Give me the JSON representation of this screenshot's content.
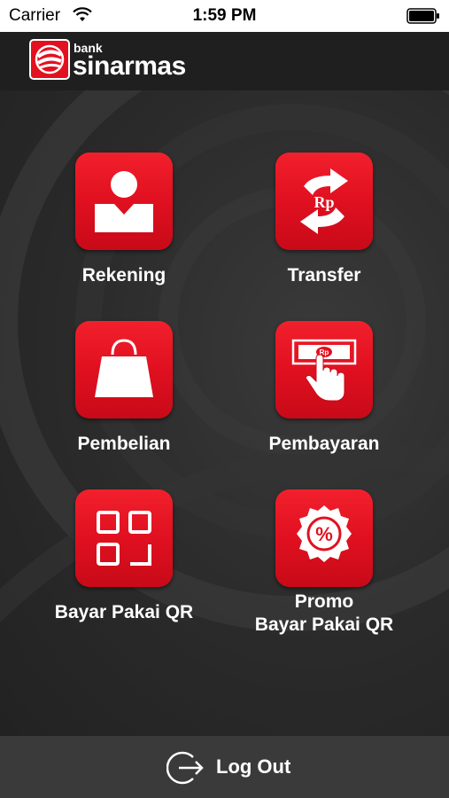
{
  "status_bar": {
    "carrier": "Carrier",
    "time": "1:59 PM"
  },
  "header": {
    "bank": "bank",
    "brand": "sinarmas"
  },
  "menu": [
    {
      "label": "Rekening",
      "icon": "person-icon"
    },
    {
      "label": "Transfer",
      "icon": "transfer-rp-icon",
      "icon_text": "Rp"
    },
    {
      "label": "Pembelian",
      "icon": "shopping-bag-icon"
    },
    {
      "label": "Pembayaran",
      "icon": "payment-hand-icon",
      "icon_text": "Rp"
    },
    {
      "label": "Bayar Pakai QR",
      "icon": "qr-icon"
    },
    {
      "label_line1": "Promo",
      "label_line2": "Bayar Pakai QR",
      "icon": "promo-percent-icon",
      "icon_text": "%"
    }
  ],
  "footer": {
    "logout_label": "Log Out"
  },
  "colors": {
    "accent": "#e3101f",
    "background": "#2b2b2b",
    "footer": "#3a3a3a"
  }
}
